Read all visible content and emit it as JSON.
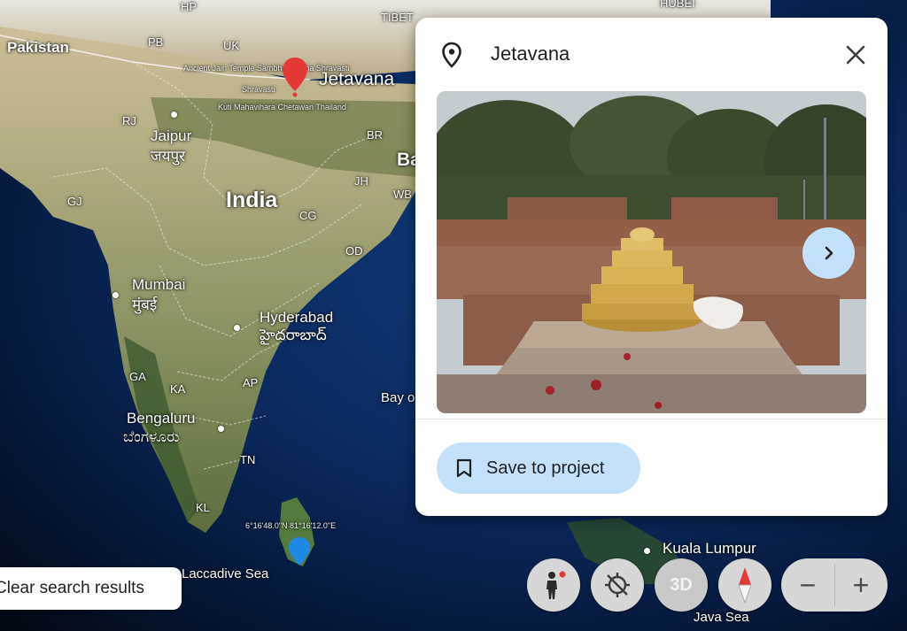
{
  "map": {
    "labels": {
      "hp": "HP",
      "tibet": "TIBET",
      "hubei": "HUBEI",
      "pakistan": "Pakistan",
      "pb": "PB",
      "uk": "UK",
      "cluster": "Ancient Jain Temple Sambhav Natha Shravasti",
      "jetavana": "Jetavana",
      "shravasti": "Shravasti",
      "kuti": "Kuti Mahavihara Chetawan Thailand",
      "rj": "RJ",
      "jaipur": "Jaipur",
      "jaipur_local": "जयपुर",
      "br": "BR",
      "ba": "Ba",
      "india": "India",
      "jh": "JH",
      "wb": "WB",
      "gj": "GJ",
      "cg": "CG",
      "od": "OD",
      "mumbai": "Mumbai",
      "mumbai_local": "मुंबई",
      "hyderabad": "Hyderabad",
      "hyderabad_local": "హైదరాబాద్",
      "ga": "GA",
      "ka": "KA",
      "ap": "AP",
      "bay": "Bay o",
      "bengaluru": "Bengaluru",
      "bengaluru_local": "ಬೆಂಗಳೂರು",
      "tn": "TN",
      "kl": "KL",
      "coords": "6°16'48.0\"N 81°16'12.0\"E",
      "laccadive": "Laccadive Sea",
      "kuala_lumpur": "Kuala Lumpur",
      "java_sea": "Java Sea"
    }
  },
  "place_card": {
    "title": "Jetavana",
    "save_label": "Save to project",
    "pin_icon": "location-pin-icon",
    "close_icon": "close-icon",
    "next_icon": "chevron-right-icon",
    "bookmark_icon": "bookmark-icon"
  },
  "clear_search_label": "Clear search results",
  "controls": {
    "three_d_label": "3D",
    "zoom_out_label": "−",
    "zoom_in_label": "+",
    "pegman_icon": "pegman-icon",
    "location_icon": "location-off-icon",
    "compass_icon": "compass-icon"
  },
  "colors": {
    "accent_button": "#c4e1fb",
    "marker_red": "#e53935",
    "marker_blue": "#1e88e5"
  }
}
